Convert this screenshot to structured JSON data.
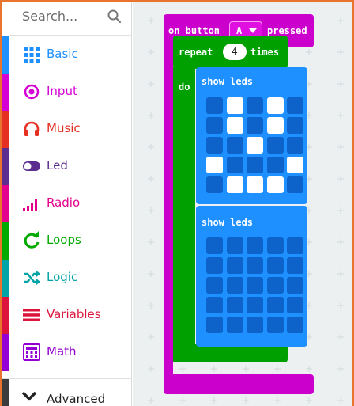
{
  "search": {
    "placeholder": "Search..."
  },
  "categories": [
    {
      "label": "Basic",
      "color": "#1e90ff",
      "icon": "grid-icon"
    },
    {
      "label": "Input",
      "color": "#d400d4",
      "icon": "target-icon"
    },
    {
      "label": "Music",
      "color": "#e63022",
      "icon": "headphones-icon"
    },
    {
      "label": "Led",
      "color": "#5c2d91",
      "icon": "toggle-icon"
    },
    {
      "label": "Radio",
      "color": "#e3008c",
      "icon": "signal-bars-icon"
    },
    {
      "label": "Loops",
      "color": "#00aa00",
      "icon": "refresh-icon"
    },
    {
      "label": "Logic",
      "color": "#00a4a6",
      "icon": "shuffle-icon"
    },
    {
      "label": "Variables",
      "color": "#dc143c",
      "icon": "list-icon"
    },
    {
      "label": "Math",
      "color": "#9400d3",
      "icon": "calculator-icon"
    }
  ],
  "advanced": {
    "label": "Advanced",
    "icon": "chevron-down-icon"
  },
  "blocks": {
    "event": {
      "prefix": "on button",
      "button": "A",
      "suffix": "pressed"
    },
    "repeat": {
      "prefix": "repeat",
      "count": "4",
      "suffix": "times",
      "do_label": "do"
    },
    "show_leds_1": {
      "label": "show leds",
      "grid": [
        [
          0,
          1,
          0,
          1,
          0
        ],
        [
          0,
          1,
          0,
          1,
          0
        ],
        [
          0,
          0,
          1,
          0,
          0
        ],
        [
          1,
          0,
          0,
          0,
          1
        ],
        [
          0,
          1,
          1,
          1,
          0
        ]
      ]
    },
    "show_leds_2": {
      "label": "show leds",
      "grid": [
        [
          0,
          0,
          0,
          0,
          0
        ],
        [
          0,
          0,
          0,
          0,
          0
        ],
        [
          0,
          0,
          0,
          0,
          0
        ],
        [
          0,
          0,
          0,
          0,
          0
        ],
        [
          0,
          0,
          0,
          0,
          0
        ]
      ]
    }
  }
}
